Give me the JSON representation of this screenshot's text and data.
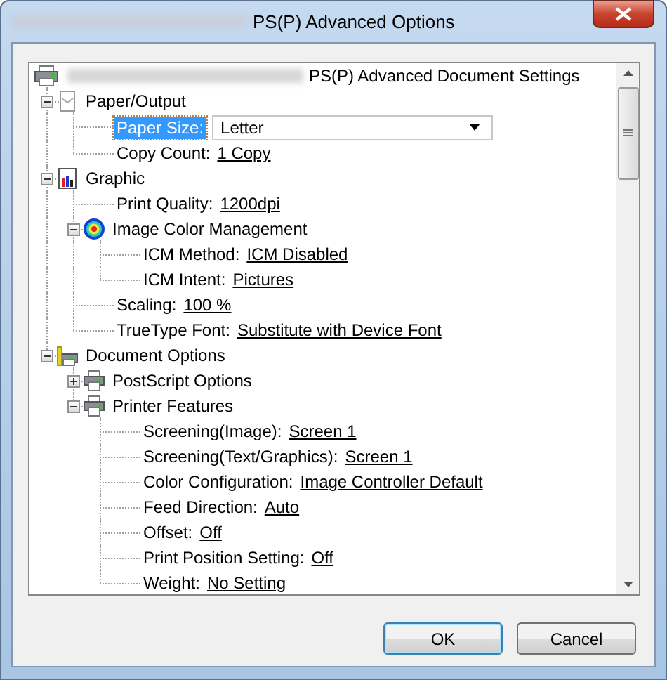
{
  "window": {
    "title": "PS(P) Advanced Options"
  },
  "tree": {
    "title": "PS(P) Advanced Document Settings",
    "children": [
      {
        "kind": "group",
        "label": "Paper/Output",
        "expanded": true,
        "selected": false,
        "children": [
          {
            "kind": "dropdown",
            "label": "Paper Size:",
            "value": "Letter",
            "selected": true
          },
          {
            "kind": "setting",
            "label": "Copy Count:",
            "value": "1 Copy",
            "selected": false
          }
        ]
      },
      {
        "kind": "group",
        "label": "Graphic",
        "expanded": true,
        "selected": false,
        "children": [
          {
            "kind": "setting",
            "label": "Print Quality:",
            "value": "1200dpi",
            "selected": false
          },
          {
            "kind": "group",
            "label": "Image Color Management",
            "expanded": true,
            "selected": false,
            "children": [
              {
                "kind": "setting",
                "label": "ICM Method:",
                "value": "ICM Disabled",
                "selected": false
              },
              {
                "kind": "setting",
                "label": "ICM Intent:",
                "value": "Pictures",
                "selected": false
              }
            ]
          },
          {
            "kind": "setting",
            "label": "Scaling:",
            "value": "100 %",
            "selected": false
          },
          {
            "kind": "setting",
            "label": "TrueType Font:",
            "value": "Substitute with Device Font",
            "selected": false
          }
        ]
      },
      {
        "kind": "group",
        "label": "Document Options",
        "expanded": true,
        "selected": false,
        "children": [
          {
            "kind": "group",
            "label": "PostScript Options",
            "expanded": false,
            "selected": false
          },
          {
            "kind": "group",
            "label": "Printer Features",
            "expanded": true,
            "selected": false,
            "children": [
              {
                "kind": "setting",
                "label": "Screening(Image):",
                "value": "Screen 1",
                "selected": false
              },
              {
                "kind": "setting",
                "label": "Screening(Text/Graphics):",
                "value": "Screen 1",
                "selected": false
              },
              {
                "kind": "setting",
                "label": "Color Configuration:",
                "value": "Image Controller Default",
                "selected": false
              },
              {
                "kind": "setting",
                "label": "Feed Direction:",
                "value": "Auto",
                "selected": false
              },
              {
                "kind": "setting",
                "label": "Offset:",
                "value": "Off",
                "selected": false
              },
              {
                "kind": "setting",
                "label": "Print Position Setting:",
                "value": "Off",
                "selected": false
              },
              {
                "kind": "setting",
                "label": "Weight:",
                "value": "No Setting",
                "selected": false
              }
            ]
          }
        ]
      }
    ]
  },
  "buttons": [
    {
      "label": "OK",
      "default": true
    },
    {
      "label": "Cancel",
      "default": false
    }
  ]
}
